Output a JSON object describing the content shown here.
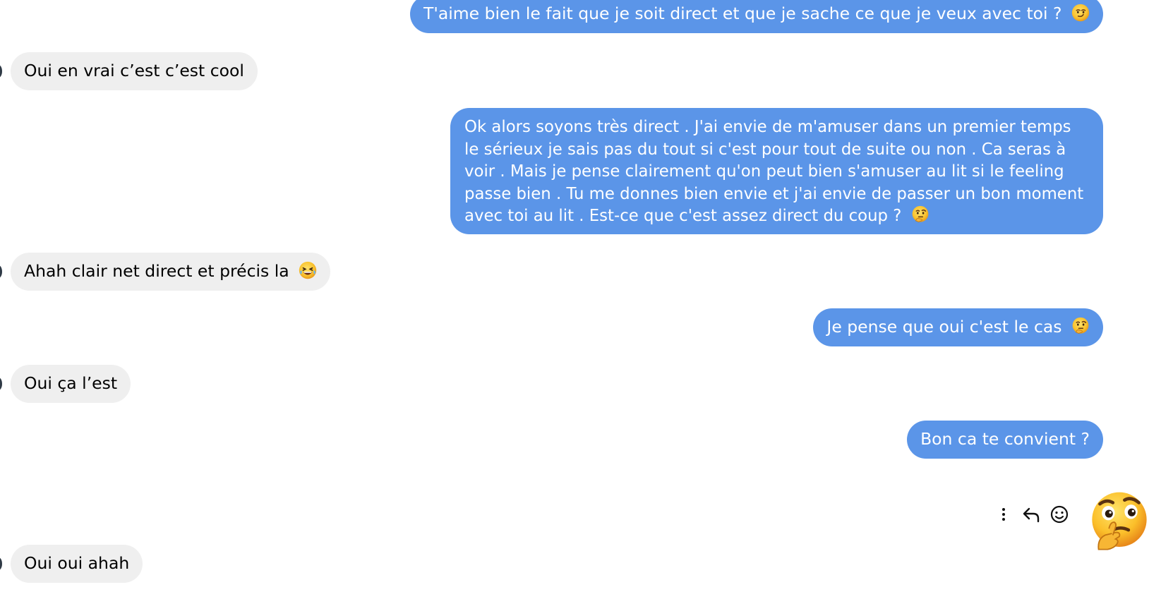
{
  "conversation": {
    "messages": [
      {
        "direction": "outgoing",
        "text": "T'aime bien le fait que je soit direct et que je sache ce que je veux avec toi ?",
        "emoji": "smirk-face-icon"
      },
      {
        "direction": "incoming",
        "text": "Oui en vrai c’est c’est cool"
      },
      {
        "direction": "outgoing",
        "text": "Ok alors soyons très direct . J'ai envie de m'amuser dans un premier temps le sérieux je sais pas du tout si c'est pour tout de suite ou non . Ca seras à voir . Mais je pense clairement qu'on peut bien s'amuser au lit si le feeling passe bien . Tu me donnes bien envie et j'ai envie de passer un bon moment avec toi au lit . Est-ce que c'est assez direct du coup ?",
        "emoji": "thinking-face-icon"
      },
      {
        "direction": "incoming",
        "text": "Ahah clair net direct et précis la",
        "emoji": "laughing-face-icon"
      },
      {
        "direction": "outgoing",
        "text": "Je pense que oui c'est le cas",
        "emoji": "thinking-face-icon"
      },
      {
        "direction": "incoming",
        "text": "Oui ça l’est"
      },
      {
        "direction": "outgoing",
        "text": "Bon ca te convient ?"
      },
      {
        "direction": "outgoing",
        "type": "large-emoji",
        "emoji": "thinking-face-icon"
      },
      {
        "direction": "incoming",
        "text": "Oui oui ahah"
      }
    ]
  },
  "hover_actions": [
    "more-options-icon",
    "reply-icon",
    "react-icon"
  ],
  "colors": {
    "outgoing_bubble": "#5b95e8",
    "incoming_bubble": "#efefef",
    "outgoing_text": "#ffffff",
    "incoming_text": "#000000"
  }
}
